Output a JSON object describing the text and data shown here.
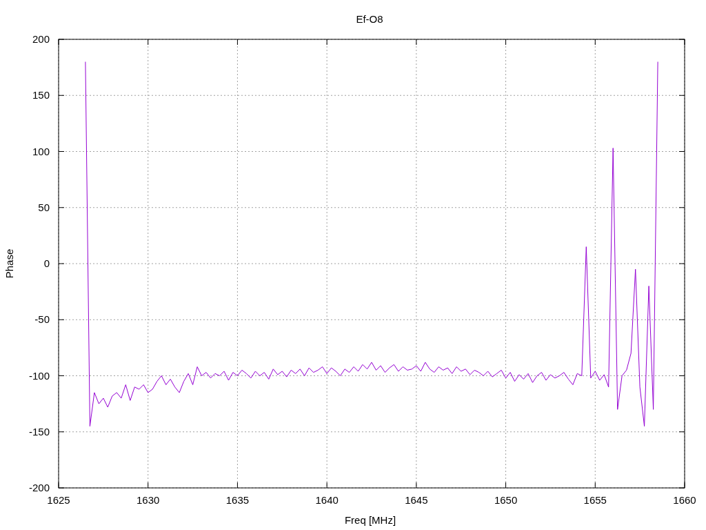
{
  "plot": {
    "chart_data": {
      "type": "line",
      "title": "Ef-O8",
      "xlabel": "Freq [MHz]",
      "ylabel": "Phase",
      "x": [
        1626.5,
        1626.75,
        1627,
        1627.25,
        1627.5,
        1627.75,
        1628,
        1628.25,
        1628.5,
        1628.75,
        1629,
        1629.25,
        1629.5,
        1629.75,
        1630,
        1630.25,
        1630.5,
        1630.75,
        1631,
        1631.25,
        1631.5,
        1631.75,
        1632,
        1632.25,
        1632.5,
        1632.75,
        1633,
        1633.25,
        1633.5,
        1633.75,
        1634,
        1634.25,
        1634.5,
        1634.75,
        1635,
        1635.25,
        1635.5,
        1635.75,
        1636,
        1636.25,
        1636.5,
        1636.75,
        1637,
        1637.25,
        1637.5,
        1637.75,
        1638,
        1638.25,
        1638.5,
        1638.75,
        1639,
        1639.25,
        1639.5,
        1639.75,
        1640,
        1640.25,
        1640.5,
        1640.75,
        1641,
        1641.25,
        1641.5,
        1641.75,
        1642,
        1642.25,
        1642.5,
        1642.75,
        1643,
        1643.25,
        1643.5,
        1643.75,
        1644,
        1644.25,
        1644.5,
        1644.75,
        1645,
        1645.25,
        1645.5,
        1645.75,
        1646,
        1646.25,
        1646.5,
        1646.75,
        1647,
        1647.25,
        1647.5,
        1647.75,
        1648,
        1648.25,
        1648.5,
        1648.75,
        1649,
        1649.25,
        1649.5,
        1649.75,
        1650,
        1650.25,
        1650.5,
        1650.75,
        1651,
        1651.25,
        1651.5,
        1651.75,
        1652,
        1652.25,
        1652.5,
        1652.75,
        1653,
        1653.25,
        1653.5,
        1653.75,
        1654,
        1654.25,
        1654.5,
        1654.75,
        1655,
        1655.25,
        1655.5,
        1655.75,
        1656,
        1656.25,
        1656.5,
        1656.75,
        1657,
        1657.25,
        1657.5,
        1657.75,
        1658,
        1658.25,
        1658.5
      ],
      "series": [
        {
          "color": "#9400d3",
          "values": [
            180,
            -145,
            -115,
            -125,
            -120,
            -128,
            -118,
            -115,
            -120,
            -108,
            -122,
            -110,
            -112,
            -108,
            -115,
            -112,
            -105,
            -100,
            -108,
            -103,
            -110,
            -115,
            -105,
            -98,
            -108,
            -92,
            -100,
            -97,
            -102,
            -98,
            -100,
            -96,
            -104,
            -97,
            -100,
            -95,
            -98,
            -102,
            -96,
            -100,
            -97,
            -103,
            -94,
            -99,
            -96,
            -101,
            -95,
            -98,
            -94,
            -100,
            -93,
            -97,
            -95,
            -92,
            -98,
            -93,
            -96,
            -100,
            -94,
            -97,
            -92,
            -96,
            -90,
            -94,
            -88,
            -95,
            -91,
            -97,
            -93,
            -90,
            -96,
            -92,
            -95,
            -94,
            -91,
            -96,
            -88,
            -94,
            -97,
            -92,
            -95,
            -93,
            -98,
            -92,
            -96,
            -94,
            -99,
            -95,
            -97,
            -100,
            -96,
            -101,
            -98,
            -95,
            -102,
            -97,
            -105,
            -99,
            -103,
            -98,
            -106,
            -100,
            -97,
            -104,
            -99,
            -102,
            -100,
            -97,
            -103,
            -108,
            -98,
            -100,
            15,
            -102,
            -96,
            -104,
            -99,
            -110,
            103,
            -130,
            -100,
            -95,
            -80,
            -5,
            -110,
            -145,
            -20,
            -130,
            180
          ]
        }
      ],
      "grid": true,
      "xlim": [
        1625,
        1660
      ],
      "ylim": [
        -200,
        200
      ],
      "xticks": [
        1625,
        1630,
        1635,
        1640,
        1645,
        1650,
        1655,
        1660
      ],
      "yticks": [
        -200,
        -150,
        -100,
        -50,
        0,
        50,
        100,
        150,
        200
      ]
    }
  }
}
